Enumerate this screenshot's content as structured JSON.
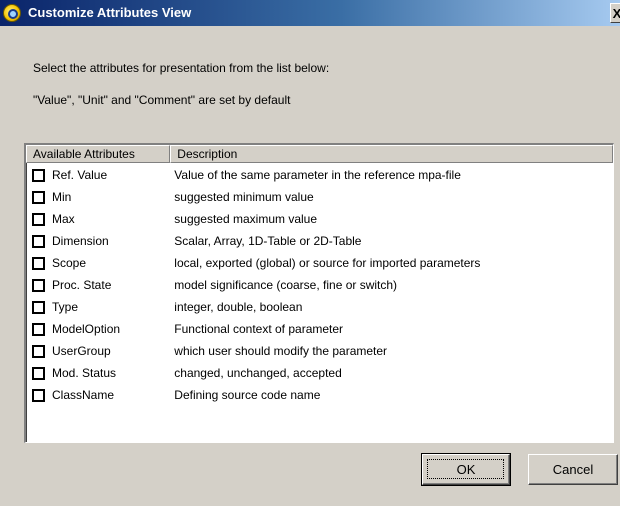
{
  "window": {
    "title": "Customize Attributes View",
    "close_glyph": "X"
  },
  "instructions": {
    "line1": "Select the attributes for presentation from the list below:",
    "line2": "\"Value\", \"Unit\" and \"Comment\" are set by default"
  },
  "list": {
    "columns": [
      "Available Attributes",
      "Description"
    ],
    "rows": [
      {
        "attribute": "Ref. Value",
        "description": "Value of the same parameter in the reference mpa-file",
        "checked": false
      },
      {
        "attribute": "Min",
        "description": "suggested minimum value",
        "checked": false
      },
      {
        "attribute": "Max",
        "description": "suggested maximum value",
        "checked": false
      },
      {
        "attribute": "Dimension",
        "description": "Scalar, Array, 1D-Table or 2D-Table",
        "checked": false
      },
      {
        "attribute": "Scope",
        "description": "local, exported (global) or source for imported parameters",
        "checked": false
      },
      {
        "attribute": "Proc. State",
        "description": "model significance (coarse, fine or switch)",
        "checked": false
      },
      {
        "attribute": "Type",
        "description": "integer, double, boolean",
        "checked": false
      },
      {
        "attribute": "ModelOption",
        "description": "Functional context of parameter",
        "checked": false
      },
      {
        "attribute": "UserGroup",
        "description": "which user should modify the parameter",
        "checked": false
      },
      {
        "attribute": "Mod. Status",
        "description": "changed, unchanged, accepted",
        "checked": false
      },
      {
        "attribute": "ClassName",
        "description": "Defining source code name",
        "checked": false
      }
    ]
  },
  "buttons": {
    "ok": "OK",
    "cancel": "Cancel"
  }
}
